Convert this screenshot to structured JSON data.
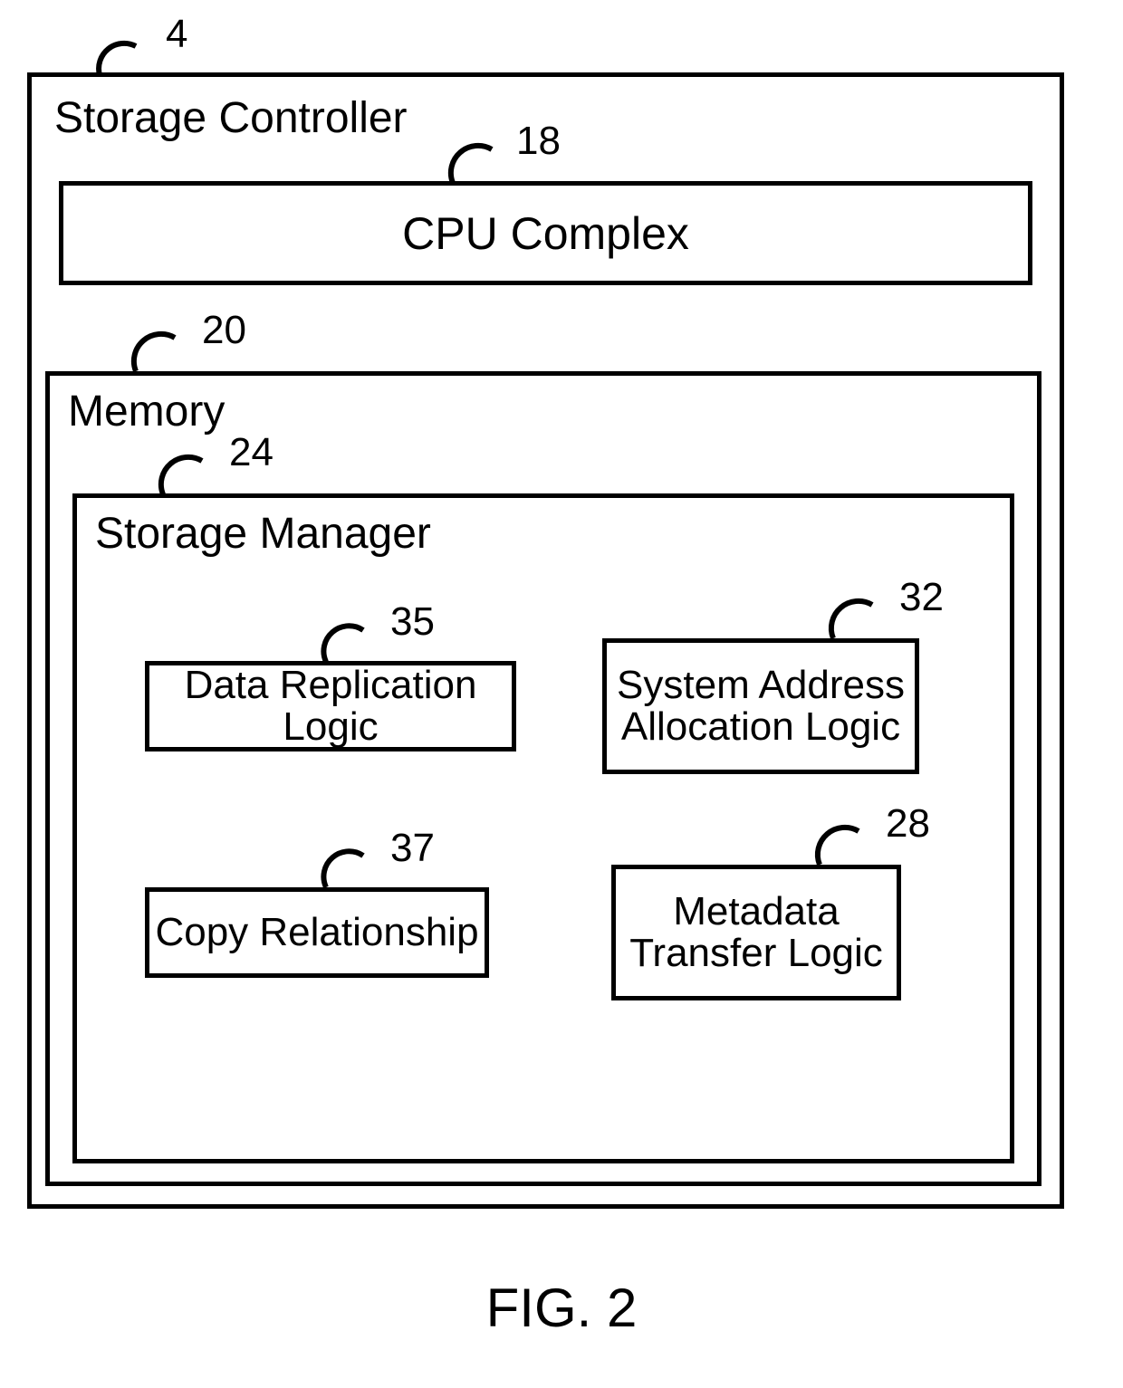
{
  "refs": {
    "outer": "4",
    "cpu": "18",
    "memory": "20",
    "mgr": "24",
    "dr": "35",
    "sa": "32",
    "cr": "37",
    "mt": "28"
  },
  "labels": {
    "outer": "Storage Controller",
    "cpu": "CPU Complex",
    "memory": "Memory",
    "mgr": "Storage Manager",
    "dr": "Data Replication Logic",
    "sa": "System Address Allocation Logic",
    "cr": "Copy Relationship",
    "mt": "Metadata Transfer Logic"
  },
  "caption": "FIG. 2"
}
